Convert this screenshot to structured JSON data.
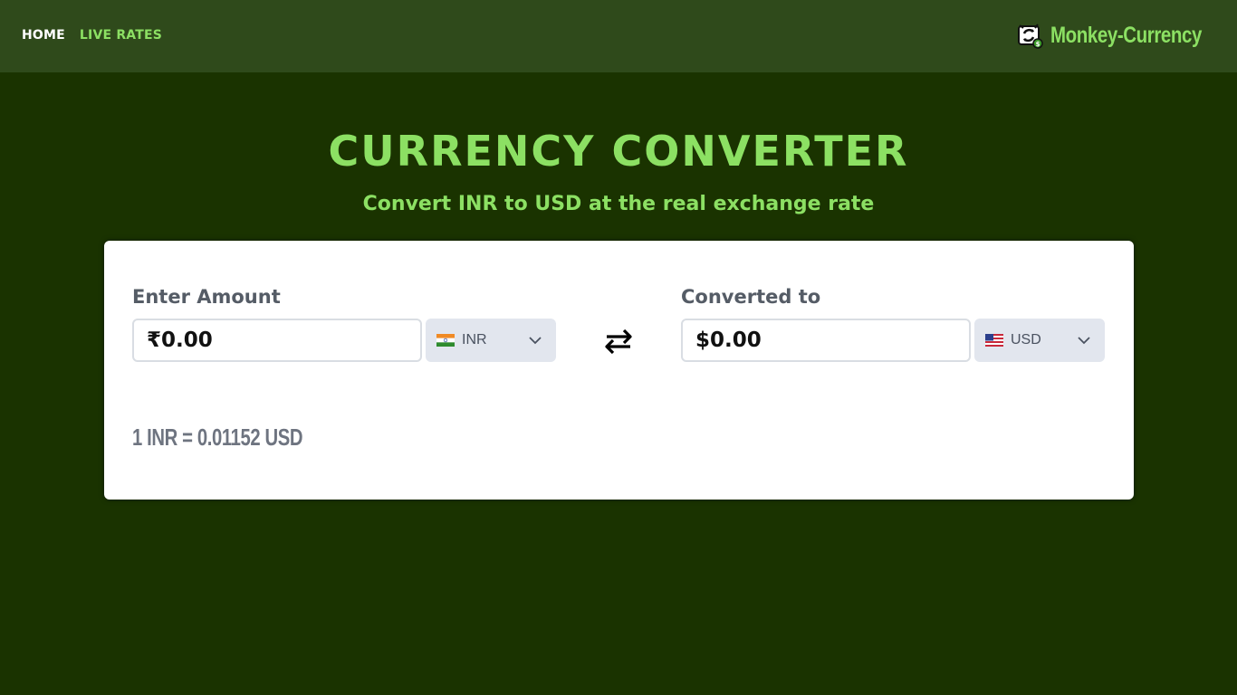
{
  "nav": {
    "links": [
      {
        "label": "HOME",
        "active": true
      },
      {
        "label": "LIVE RATES",
        "active": false
      }
    ],
    "brand_name": "Monkey-Currency",
    "brand_icon": "monkey-currency-logo-icon"
  },
  "hero": {
    "title": "CURRENCY CONVERTER",
    "subtitle": "Convert INR to USD at the real exchange rate"
  },
  "converter": {
    "from": {
      "label": "Enter Amount",
      "amount": "₹0.00",
      "currency": "INR",
      "flag_icon": "india-flag-icon"
    },
    "to": {
      "label": "Converted to",
      "amount": "$0.00",
      "currency": "USD",
      "flag_icon": "us-flag-icon"
    },
    "swap_icon": "swap-arrows-icon",
    "rate_text": "1 INR = 0.01152 USD"
  },
  "colors": {
    "page_bg": "#1a3300",
    "nav_bg": "#2f4a1b",
    "accent": "#8ce063",
    "card_bg": "#ffffff",
    "select_bg": "#e2e6ee"
  }
}
